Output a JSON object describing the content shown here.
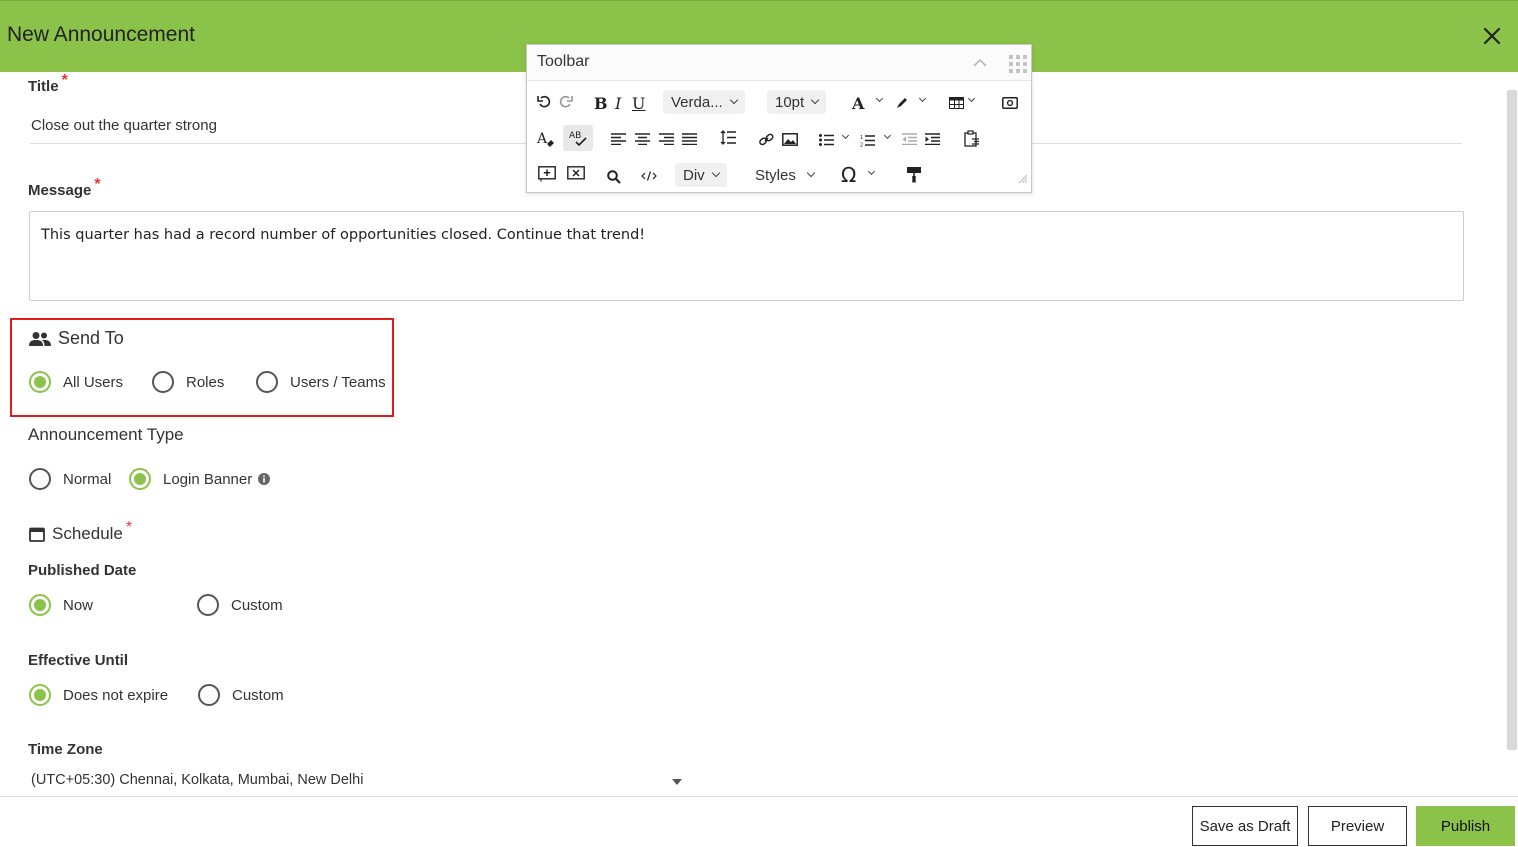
{
  "header": {
    "title": "New Announcement"
  },
  "form": {
    "title_label": "Title",
    "title_value": "Close out the quarter strong",
    "message_label": "Message",
    "message_value": "This quarter has had a record number of opportunities closed. Continue that trend!",
    "required_mark": "*"
  },
  "send_to": {
    "heading": "Send To",
    "options": [
      {
        "label": "All Users",
        "selected": true
      },
      {
        "label": "Roles",
        "selected": false
      },
      {
        "label": "Users / Teams",
        "selected": false
      }
    ]
  },
  "announcement_type": {
    "heading": "Announcement Type",
    "options": [
      {
        "label": "Normal",
        "selected": false
      },
      {
        "label": "Login Banner",
        "selected": true
      }
    ]
  },
  "schedule": {
    "heading": "Schedule",
    "published_label": "Published Date",
    "published_options": [
      {
        "label": "Now",
        "selected": true
      },
      {
        "label": "Custom",
        "selected": false
      }
    ],
    "effective_label": "Effective Until",
    "effective_options": [
      {
        "label": "Does not expire",
        "selected": true
      },
      {
        "label": "Custom",
        "selected": false
      }
    ],
    "timezone_label": "Time Zone",
    "timezone_value": "(UTC+05:30) Chennai, Kolkata, Mumbai, New Delhi"
  },
  "footer": {
    "save_draft": "Save as Draft",
    "preview": "Preview",
    "publish": "Publish"
  },
  "toolbar": {
    "title": "Toolbar",
    "font_name": "Verda...",
    "font_size": "10pt",
    "block_format": "Div",
    "styles": "Styles",
    "bold": "B",
    "italic": "I",
    "underline": "U",
    "font_color": "A",
    "omega": "Ω"
  },
  "colors": {
    "accent": "#8bc34a",
    "highlight": "#e01b1b",
    "required": "#e53935"
  }
}
